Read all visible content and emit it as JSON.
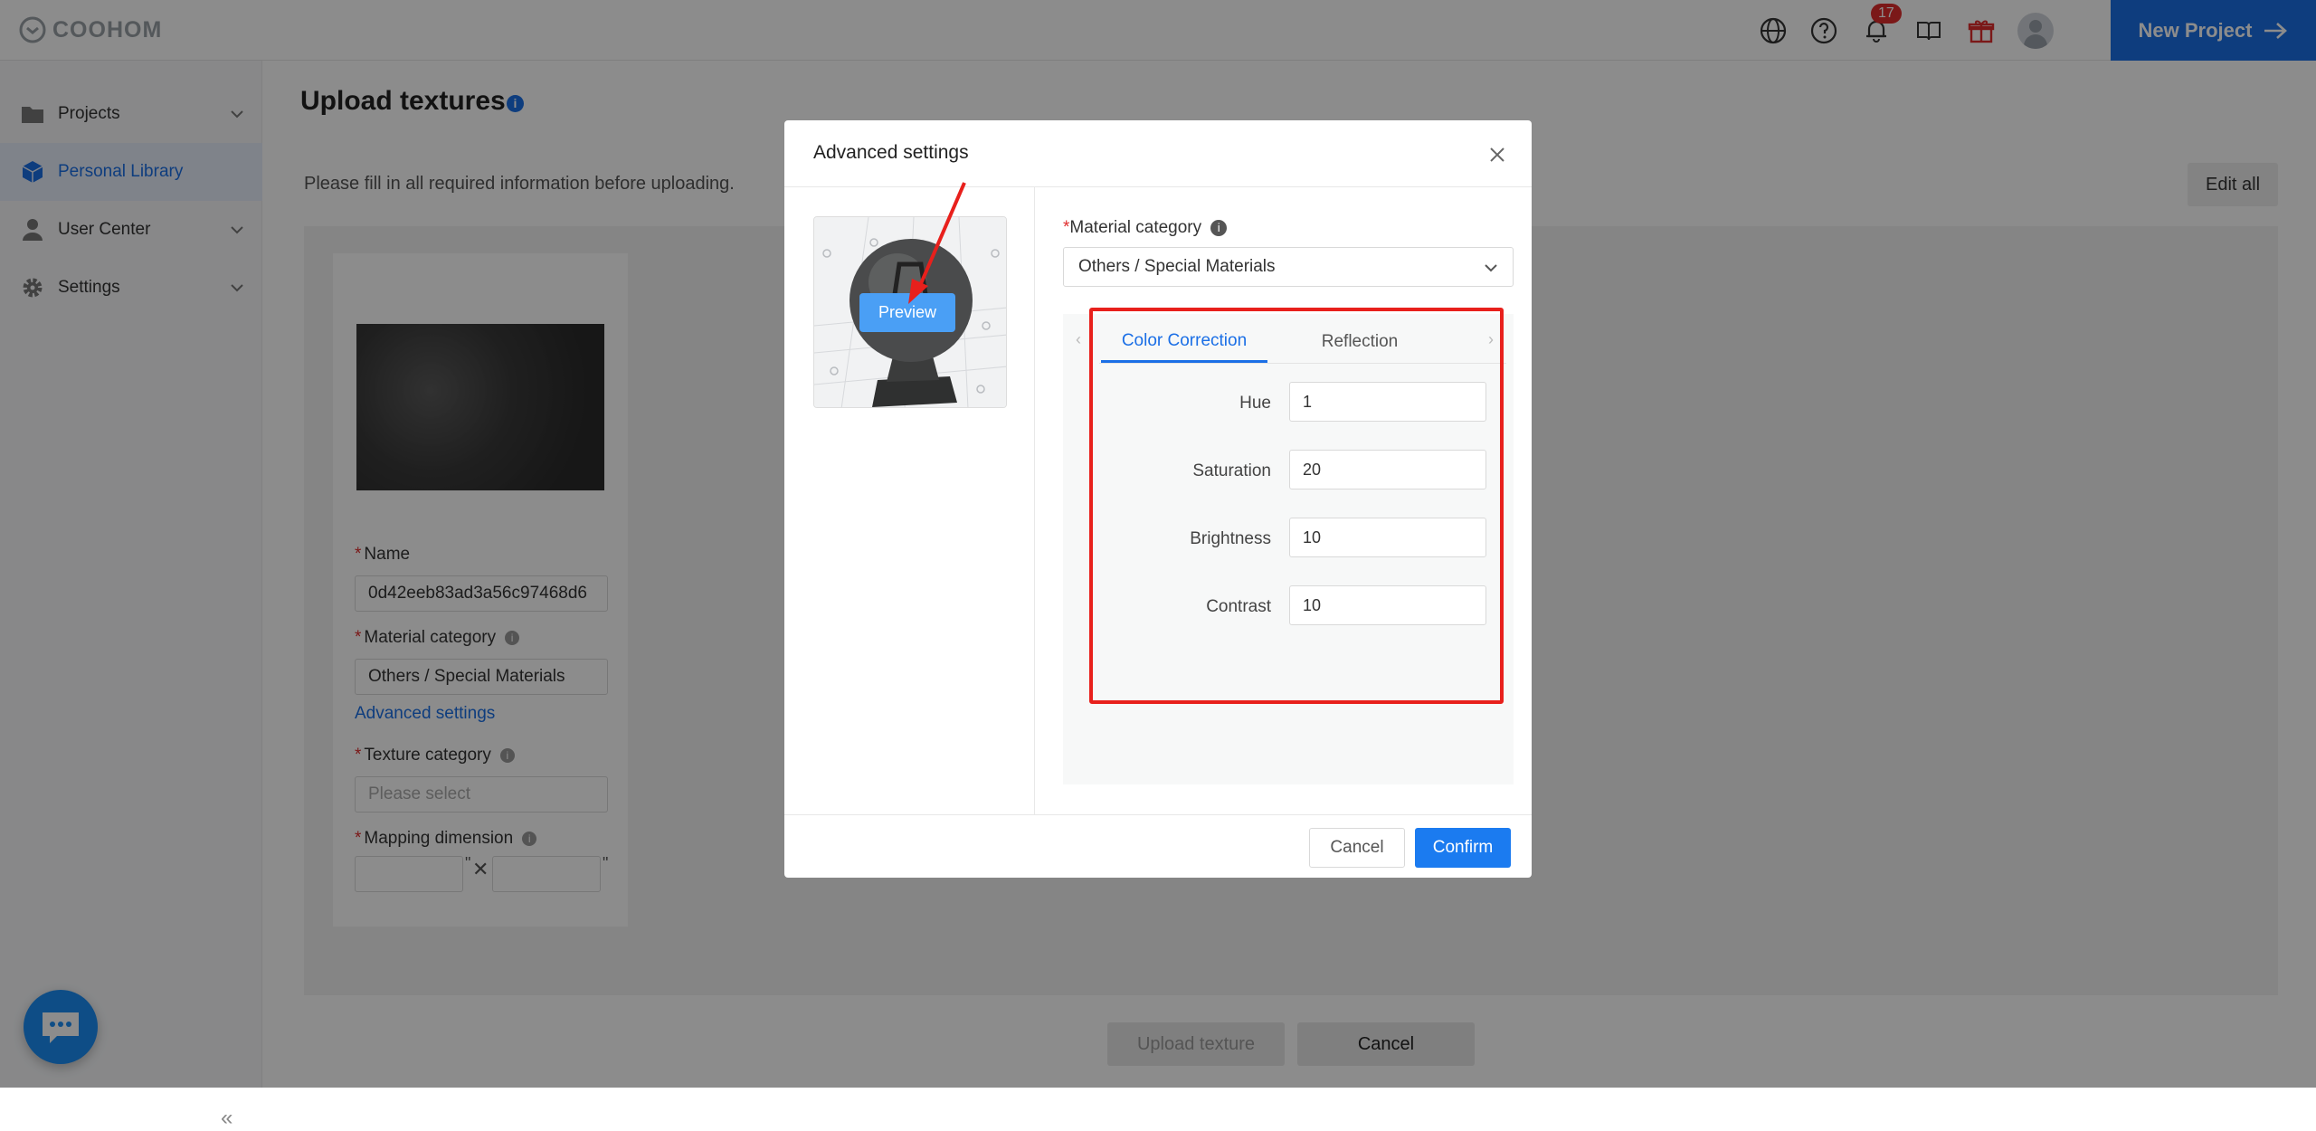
{
  "header": {
    "logo_text": "COOHOM",
    "notification_count": "17",
    "new_project_label": "New Project",
    "icons": [
      "globe-icon",
      "help-icon",
      "bell-icon",
      "book-icon",
      "gift-icon",
      "avatar"
    ]
  },
  "sidebar": {
    "items": [
      {
        "label": "Projects",
        "icon": "folder-icon"
      },
      {
        "label": "Personal Library",
        "icon": "cube-icon"
      },
      {
        "label": "User Center",
        "icon": "user-icon"
      },
      {
        "label": "Settings",
        "icon": "gear-icon"
      }
    ],
    "collapse_label": "«"
  },
  "main": {
    "title": "Upload textures",
    "hint": "Please fill in all required information before uploading.",
    "edit_all_label": "Edit all",
    "card": {
      "name_label": "Name",
      "name_value": "0d42eeb83ad3a56c97468d6",
      "material_category_label": "Material category",
      "material_category_value": "Others / Special Materials",
      "advanced_settings_link": "Advanced settings",
      "texture_category_label": "Texture category",
      "texture_category_placeholder": "Please select",
      "mapping_dimension_label": "Mapping dimension",
      "dimension_unit": "\"",
      "dimension_separator": "✕"
    },
    "upload_button": "Upload texture",
    "cancel_button": "Cancel"
  },
  "modal": {
    "title": "Advanced settings",
    "preview_label": "Preview",
    "material_category_label": "Material category",
    "material_category_value": "Others / Special Materials",
    "tabs": [
      {
        "label": "Color Correction",
        "active": true
      },
      {
        "label": "Reflection",
        "active": false
      }
    ],
    "fields": [
      {
        "label": "Hue",
        "value": "1"
      },
      {
        "label": "Saturation",
        "value": "20"
      },
      {
        "label": "Brightness",
        "value": "10"
      },
      {
        "label": "Contrast",
        "value": "10"
      }
    ],
    "cancel_label": "Cancel",
    "confirm_label": "Confirm"
  },
  "colors": {
    "accent": "#1b6fe6",
    "annotation_red": "#e8201c",
    "required_red": "#e02d2d"
  }
}
